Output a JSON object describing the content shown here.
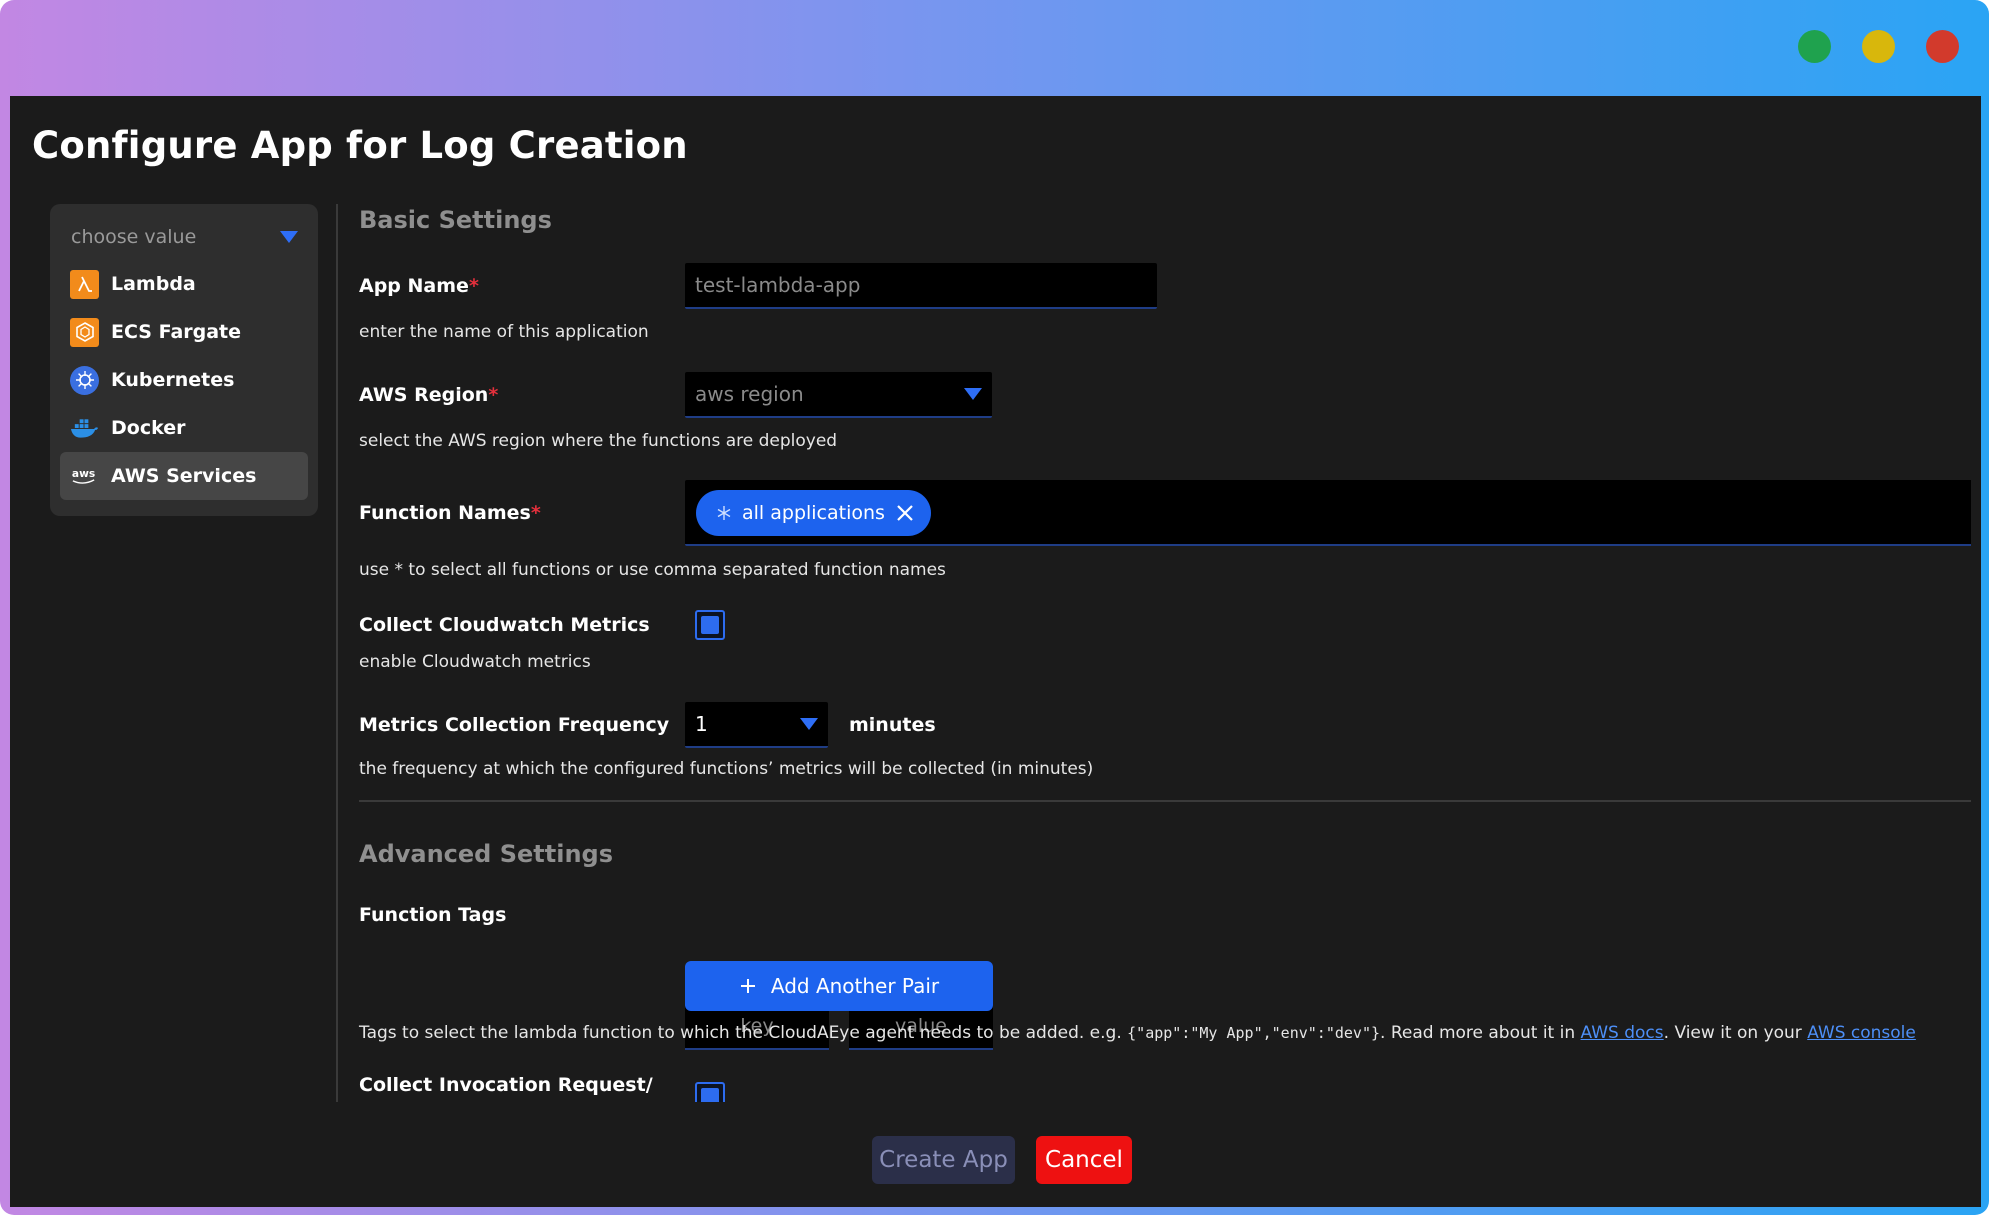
{
  "window": {
    "title": "Configure App for Log Creation",
    "controls": {
      "green": "#1fa24e",
      "yellow": "#d8b70c",
      "red": "#d23a2c"
    }
  },
  "sidebar": {
    "select_placeholder": "choose value",
    "items": [
      {
        "label": "Lambda",
        "icon": "lambda-icon",
        "active": false
      },
      {
        "label": "ECS Fargate",
        "icon": "ecs-fargate-icon",
        "active": false
      },
      {
        "label": "Kubernetes",
        "icon": "kubernetes-icon",
        "active": false
      },
      {
        "label": "Docker",
        "icon": "docker-icon",
        "active": false
      },
      {
        "label": "AWS Services",
        "icon": "aws-icon",
        "active": true
      }
    ]
  },
  "basic": {
    "title": "Basic Settings",
    "app_name": {
      "label": "App Name",
      "required": "*",
      "placeholder": "test-lambda-app",
      "help": "enter the name of this application"
    },
    "aws_region": {
      "label": "AWS Region",
      "required": "*",
      "placeholder": "aws region",
      "help": "select the AWS region where the functions are deployed"
    },
    "function_names": {
      "label": "Function Names",
      "required": "*",
      "chip": "all applications",
      "help": "use * to select all functions or use comma separated function names"
    },
    "cloudwatch": {
      "label": "Collect Cloudwatch Metrics",
      "checked": true,
      "help": "enable Cloudwatch metrics"
    },
    "frequency": {
      "label": "Metrics Collection Frequency",
      "value": "1",
      "unit": "minutes",
      "help": "the frequency at which the configured functions’ metrics will be collected (in minutes)"
    }
  },
  "advanced": {
    "title": "Advanced Settings",
    "function_tags": {
      "label": "Function Tags",
      "key_placeholder": "key",
      "value_placeholder": "value",
      "add_label": "Add Another Pair",
      "help_prefix": "Tags to select the lambda function to which the CloudAEye agent needs to be added.  e.g. ",
      "help_example": "{\"app\":\"My App\",\"env\":\"dev\"}",
      "help_middle": ".  Read more about it in ",
      "docs_link": "AWS docs",
      "help_middle2": ". View it on your ",
      "console_link": "AWS console"
    },
    "invocation": {
      "label": "Collect Invocation Request/",
      "checked": true
    }
  },
  "footer": {
    "create_label": "Create App",
    "cancel_label": "Cancel"
  },
  "colors": {
    "accent": "#1d63ee",
    "danger": "#ee1111",
    "background": "#1b1b1b"
  }
}
